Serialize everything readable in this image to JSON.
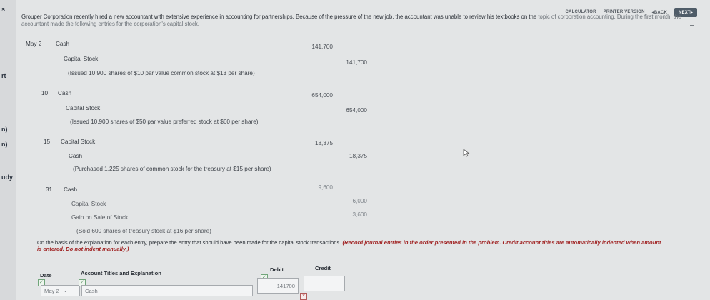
{
  "sidebar": {
    "fragments": [
      "s",
      "rt",
      "n)",
      "n)",
      "udy"
    ]
  },
  "topbar": {
    "calculator": "CALCULATOR",
    "printer_version": "PRINTER VERSION",
    "back": "◂BACK",
    "next": "NEXT▸"
  },
  "intro": {
    "text_main": "Grouper Corporation recently hired a new accountant with extensive experience in accounting for partnerships. Because of the pressure of the new job, the accountant was unable to review his textbooks on the",
    "text_tail": "topic of corporation accounting. During the first month, the accountant made the following entries for the corporation's capital stock."
  },
  "journal": {
    "e1": {
      "date": "May 2",
      "debit_account": "Cash",
      "credit_account": "Capital Stock",
      "explanation": "(Issued 10,900 shares of $10 par value common stock at $13 per share)",
      "debit": "141,700",
      "credit": "141,700"
    },
    "e2": {
      "date": "10",
      "debit_account": "Cash",
      "credit_account": "Capital Stock",
      "explanation": "(Issued 10,900 shares of $50 par value preferred stock at $60 per share)",
      "debit": "654,000",
      "credit": "654,000"
    },
    "e3": {
      "date": "15",
      "debit_account": "Capital Stock",
      "credit_account": "Cash",
      "explanation": "(Purchased 1,225 shares of common stock for the treasury at $15 per share)",
      "debit": "18,375",
      "credit": "18,375"
    },
    "e4": {
      "date": "31",
      "debit_account": "Cash",
      "credit_account": "Capital Stock",
      "credit_account_2": "Gain on Sale of Stock",
      "explanation": "(Sold 600 shares of treasury stock at $16 per share)",
      "debit": "9,600",
      "credit": "6,000",
      "credit_2": "3,600"
    }
  },
  "instructions": {
    "text": "On the basis of the explanation for each entry, prepare the entry that should have been made for the capital stock transactions.",
    "emphasis": "(Record journal entries in the order presented in the problem. Credit account titles are automatically indented when amount is entered. Do not indent manually.)"
  },
  "answer_table": {
    "headers": {
      "date": "Date",
      "account": "Account Titles and Explanation",
      "debit": "Debit",
      "credit": "Credit"
    },
    "row1": {
      "date": "May 2",
      "account": "Cash",
      "debit": "141700",
      "credit": ""
    }
  }
}
